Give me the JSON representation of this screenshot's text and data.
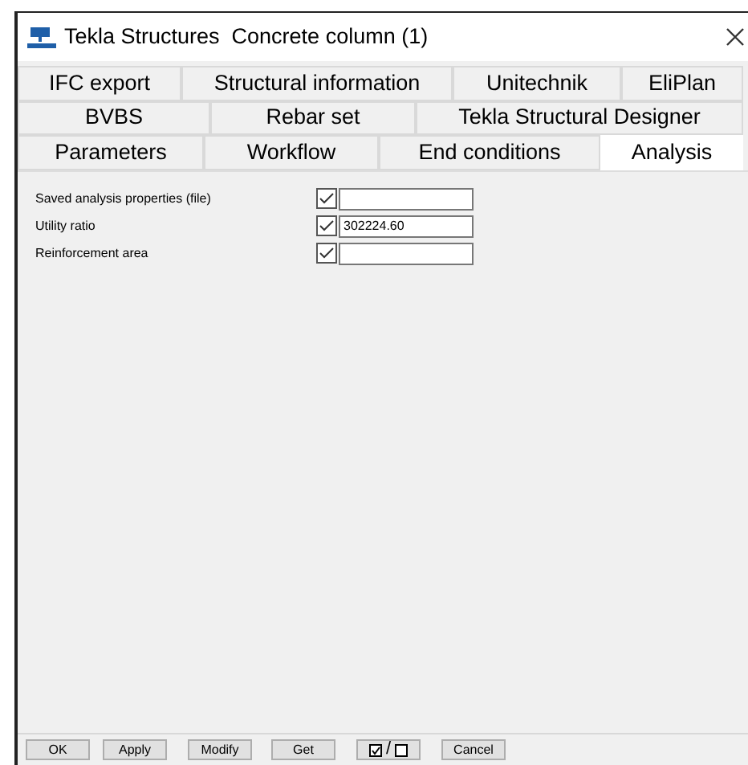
{
  "window": {
    "title": "Tekla Structures  Concrete column (1)"
  },
  "tab_rows": [
    [
      {
        "label": "IFC export",
        "selected": false
      },
      {
        "label": "Structural information",
        "selected": false
      },
      {
        "label": "Unitechnik",
        "selected": false
      },
      {
        "label": "EliPlan",
        "selected": false
      }
    ],
    [
      {
        "label": "BVBS",
        "selected": false
      },
      {
        "label": "Rebar set",
        "selected": false
      },
      {
        "label": "Tekla Structural Designer",
        "selected": false
      }
    ],
    [
      {
        "label": "Parameters",
        "selected": false
      },
      {
        "label": "Workflow",
        "selected": false
      },
      {
        "label": "End conditions",
        "selected": false
      },
      {
        "label": "Analysis",
        "selected": true
      }
    ]
  ],
  "fields": [
    {
      "label": "Saved analysis properties (file)",
      "checked": true
    },
    {
      "label": "Utility ratio",
      "checked": true,
      "value": "302224.60"
    },
    {
      "label": "Reinforcement area",
      "checked": true
    }
  ],
  "buttons": [
    {
      "kind": "text",
      "label": "OK"
    },
    {
      "kind": "text",
      "label": "Apply"
    },
    {
      "kind": "text",
      "label": "Modify"
    },
    {
      "kind": "text",
      "label": "Get"
    },
    {
      "kind": "toggle",
      "label": "/"
    },
    {
      "kind": "text",
      "label": "Cancel"
    }
  ]
}
